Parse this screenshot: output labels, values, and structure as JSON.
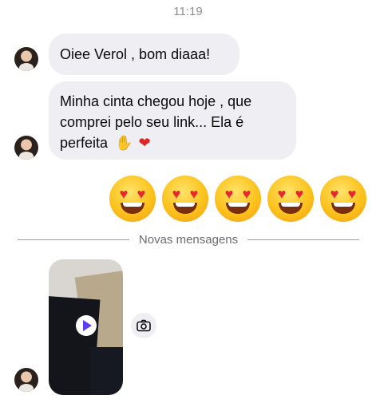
{
  "header": {
    "time": "11:19"
  },
  "messages": [
    {
      "text": "Oiee Verol , bom diaaa!"
    },
    {
      "lines": [
        "Minha cinta chegou hoje , que",
        "comprei pelo seu link... Ela é",
        "perfeita"
      ],
      "emojis": [
        "✋",
        "❤"
      ]
    }
  ],
  "reaction_emojis": [
    "heart-eyes",
    "heart-eyes",
    "heart-eyes",
    "heart-eyes",
    "heart-eyes"
  ],
  "divider": {
    "label": "Novas mensagens"
  },
  "colors": {
    "bubble": "#efeff3",
    "accent": "#5a3df0",
    "heart": "#e02424"
  }
}
